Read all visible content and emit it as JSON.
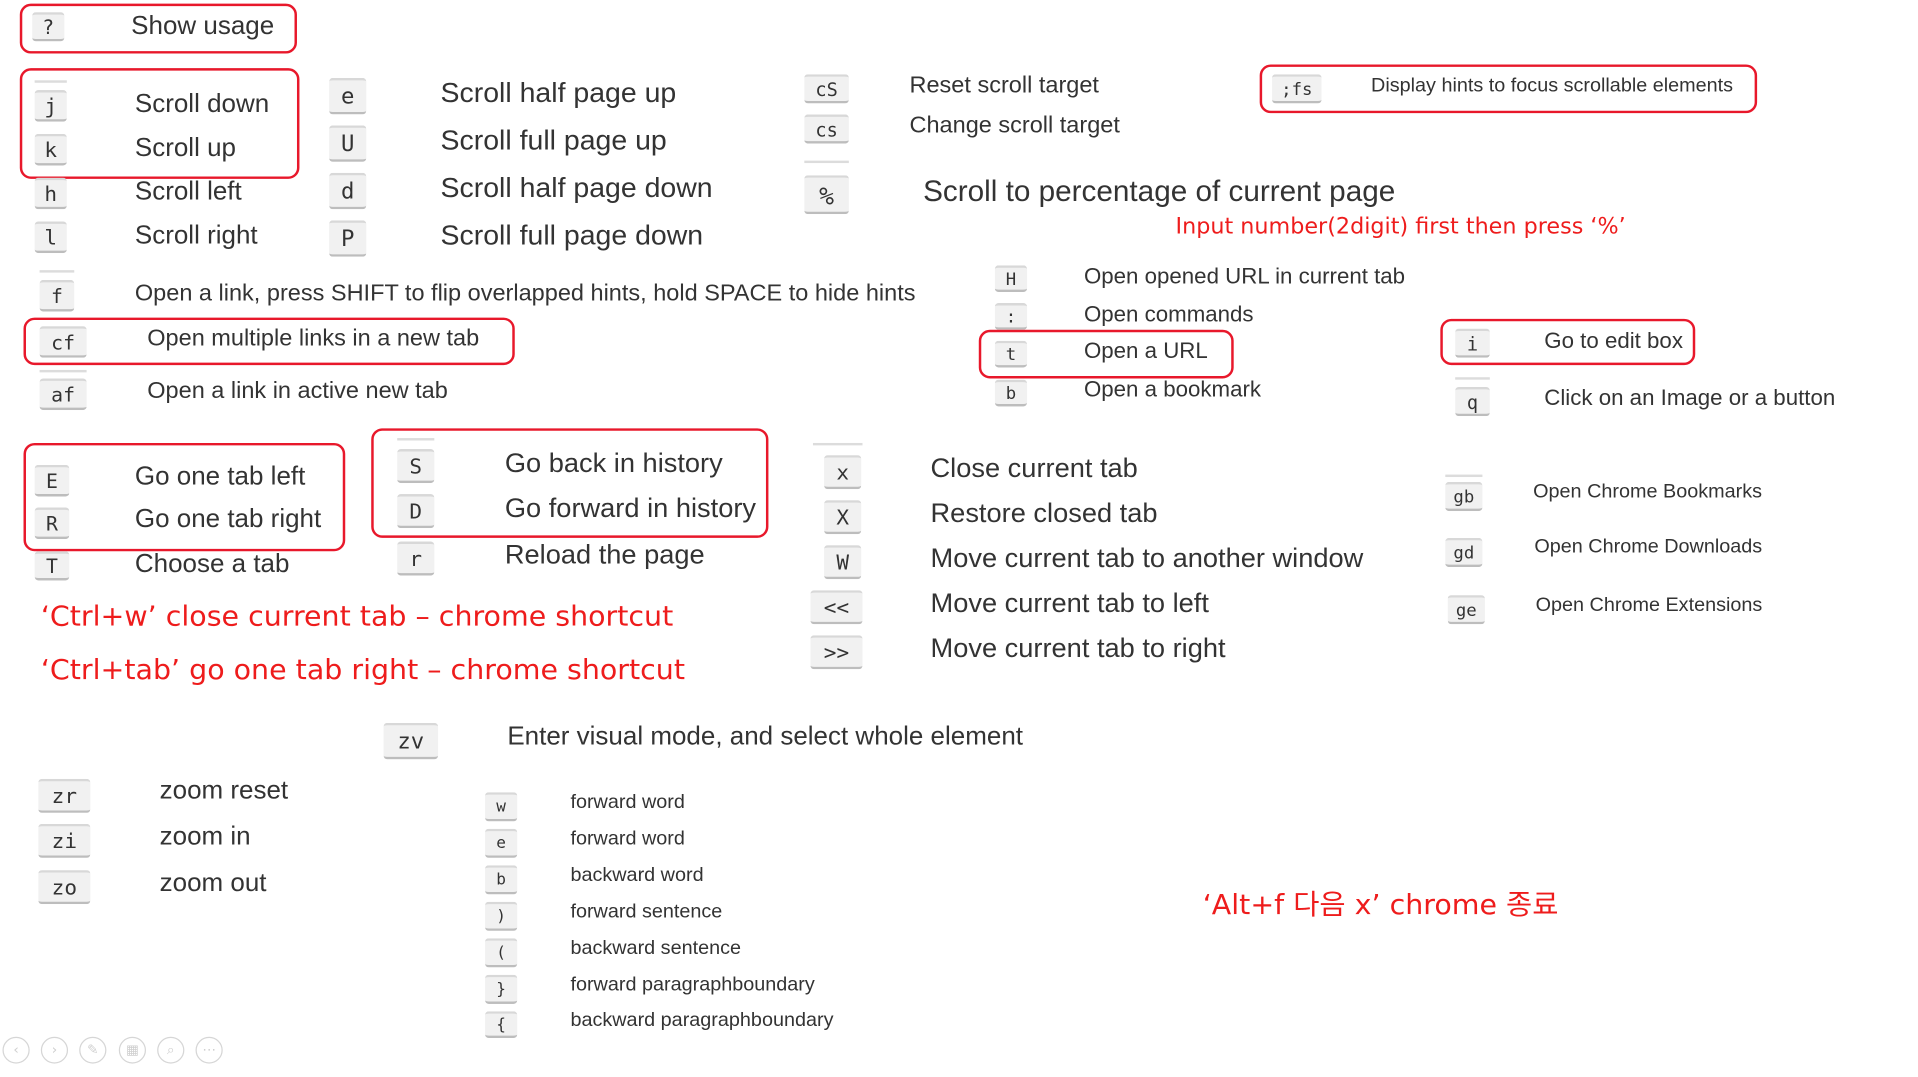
{
  "colors": {
    "highlight_border": "#e8182b",
    "note_text": "#ee1c1c",
    "key_background": "#f1f1f1",
    "body_text": "#333333"
  },
  "general": {
    "show_usage": {
      "key": "?",
      "label": "Show usage"
    }
  },
  "scrolling": {
    "scroll_down": {
      "key": "j",
      "label": "Scroll down"
    },
    "scroll_up": {
      "key": "k",
      "label": "Scroll up"
    },
    "scroll_left": {
      "key": "h",
      "label": "Scroll left"
    },
    "scroll_right": {
      "key": "l",
      "label": "Scroll right"
    },
    "half_page_up": {
      "key": "e",
      "label": "Scroll half page up"
    },
    "full_page_up": {
      "key": "U",
      "label": "Scroll full page up"
    },
    "half_page_down": {
      "key": "d",
      "label": "Scroll half page down"
    },
    "full_page_down": {
      "key": "P",
      "label": "Scroll full page down"
    },
    "reset_target": {
      "key": "cS",
      "label": "Reset scroll target"
    },
    "change_target": {
      "key": "cs",
      "label": "Change scroll target"
    },
    "percentage": {
      "key": "%",
      "label": "Scroll to percentage of current page"
    },
    "percentage_note": "Input number(2digit) first then press ‘%’",
    "scrollable_hints": {
      "key": ";fs",
      "label": "Display hints to focus scrollable elements"
    }
  },
  "links": {
    "open_link": {
      "key": "f",
      "label": "Open a link, press SHIFT to flip overlapped hints, hold SPACE to hide hints"
    },
    "multiple_links": {
      "key": "cf",
      "label": "Open multiple links in a new tab"
    },
    "active_new_tab": {
      "key": "af",
      "label": "Open a link in active new tab"
    },
    "opened_url": {
      "key": "H",
      "label": "Open opened URL in current tab"
    },
    "commands": {
      "key": ":",
      "label": "Open commands"
    },
    "open_url": {
      "key": "t",
      "label": "Open a URL"
    },
    "bookmark": {
      "key": "b",
      "label": "Open a bookmark"
    },
    "edit_box": {
      "key": "i",
      "label": "Go to edit box"
    },
    "image_button": {
      "key": "q",
      "label": "Click on an Image or a button"
    }
  },
  "tabs": {
    "tab_left": {
      "key": "E",
      "label": "Go one tab left"
    },
    "tab_right": {
      "key": "R",
      "label": "Go one tab right"
    },
    "choose_tab": {
      "key": "T",
      "label": "Choose a tab"
    },
    "back": {
      "key": "S",
      "label": "Go back in history"
    },
    "forward": {
      "key": "D",
      "label": "Go forward in history"
    },
    "reload": {
      "key": "r",
      "label": "Reload the page"
    },
    "close": {
      "key": "x",
      "label": "Close current tab"
    },
    "restore": {
      "key": "X",
      "label": "Restore closed tab"
    },
    "move_window": {
      "key": "W",
      "label": "Move current tab to another window"
    },
    "move_left": {
      "key": "<<",
      "label": "Move current tab to left"
    },
    "move_right": {
      "key": ">>",
      "label": "Move current tab to right"
    }
  },
  "chrome": {
    "bookmarks": {
      "key": "gb",
      "label": "Open Chrome Bookmarks"
    },
    "downloads": {
      "key": "gd",
      "label": "Open Chrome Downloads"
    },
    "extensions": {
      "key": "ge",
      "label": "Open Chrome Extensions"
    }
  },
  "notes": {
    "ctrl_w": "‘Ctrl+w’ close current tab – chrome shortcut",
    "ctrl_tab": "‘Ctrl+tab’ go one tab right – chrome shortcut",
    "alt_f": "‘Alt+f 다음 x’ chrome 종료"
  },
  "visual": {
    "visual_element": {
      "key": "zv",
      "label": "Enter visual mode, and select whole element"
    },
    "words": [
      {
        "key": "w",
        "label": "forward word"
      },
      {
        "key": "e",
        "label": "forward word"
      },
      {
        "key": "b",
        "label": "backward word"
      },
      {
        "key": ")",
        "label": "forward sentence"
      },
      {
        "key": "(",
        "label": "backward sentence"
      },
      {
        "key": "}",
        "label": "forward paragraphboundary"
      },
      {
        "key": "{",
        "label": "backward paragraphboundary"
      }
    ]
  },
  "zoom": {
    "reset": {
      "key": "zr",
      "label": "zoom reset"
    },
    "in": {
      "key": "zi",
      "label": "zoom in"
    },
    "out": {
      "key": "zo",
      "label": "zoom out"
    }
  },
  "slide_controls": {
    "prev": "‹",
    "next": "›",
    "pen": "✎",
    "slides": "▦",
    "zoom": "⌕",
    "more": "⋯",
    "icons": [
      "left-arrow-icon",
      "right-arrow-icon",
      "pen-icon",
      "slides-grid-icon",
      "magnifier-icon",
      "more-icon"
    ]
  }
}
